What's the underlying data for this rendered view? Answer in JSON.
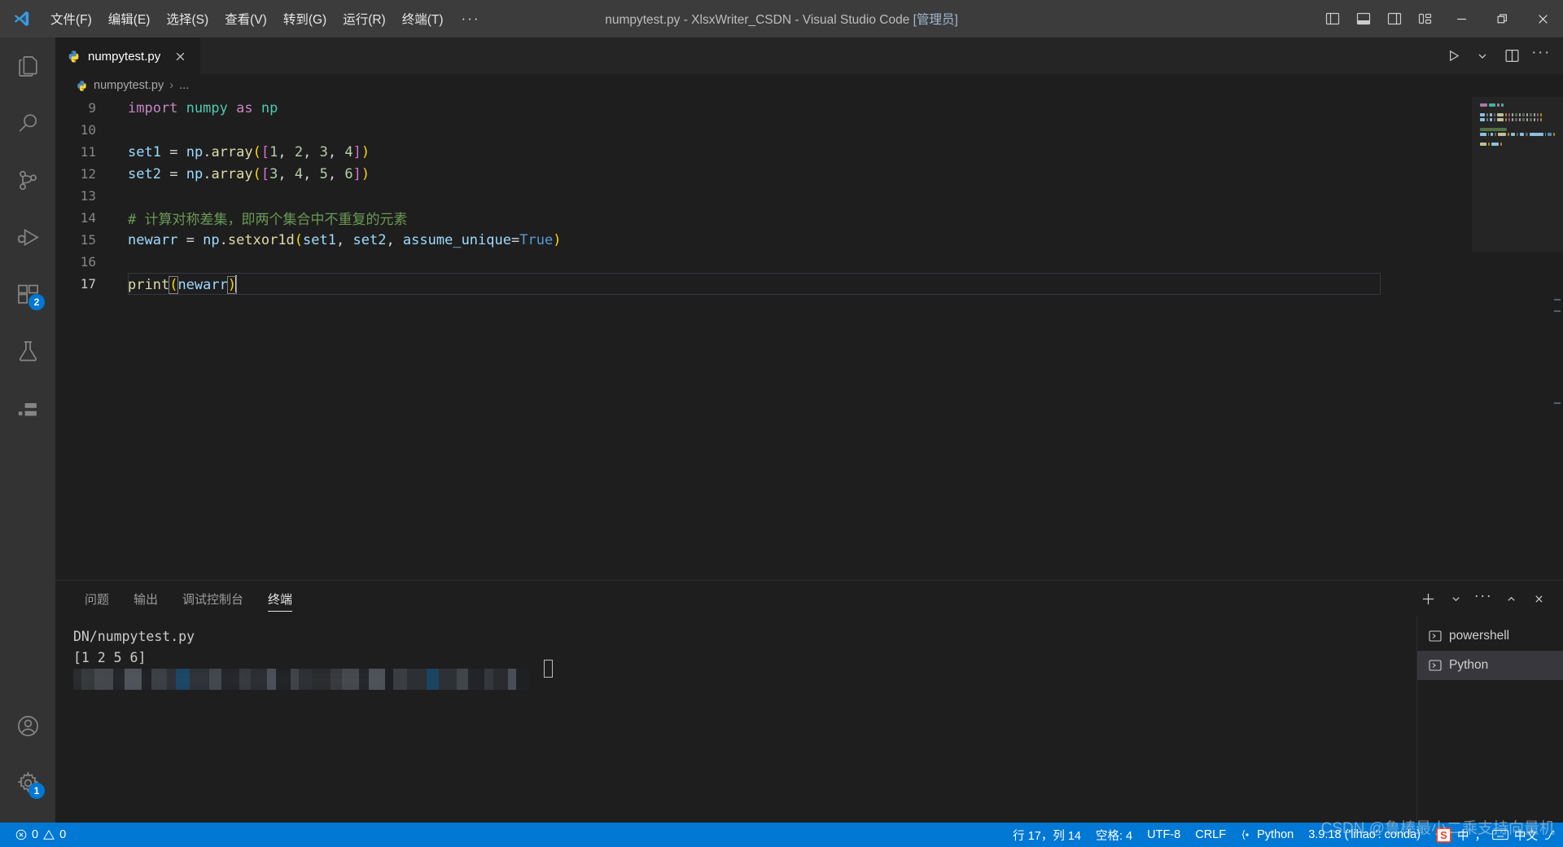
{
  "titlebar": {
    "logo_icon": "vscode-logo",
    "menus": [
      {
        "label": "文件(F)"
      },
      {
        "label": "编辑(E)"
      },
      {
        "label": "选择(S)"
      },
      {
        "label": "查看(V)"
      },
      {
        "label": "转到(G)"
      },
      {
        "label": "运行(R)"
      },
      {
        "label": "终端(T)"
      }
    ],
    "more_label": "···",
    "window_title": "numpytest.py - XlsxWriter_CSDN - Visual Studio Code ",
    "window_title_admin": "[管理员]",
    "layout_icons": [
      {
        "name": "toggle-primary-sidebar-icon"
      },
      {
        "name": "toggle-panel-icon"
      },
      {
        "name": "toggle-secondary-sidebar-icon"
      },
      {
        "name": "customize-layout-icon"
      }
    ],
    "window_controls": [
      {
        "name": "minimize-button"
      },
      {
        "name": "restore-button"
      },
      {
        "name": "close-button"
      }
    ]
  },
  "activitybar": {
    "top": [
      {
        "name": "explorer",
        "icon": "files-icon",
        "badge": ""
      },
      {
        "name": "search",
        "icon": "search-icon",
        "badge": ""
      },
      {
        "name": "source-control",
        "icon": "source-control-icon",
        "badge": ""
      },
      {
        "name": "run-and-debug",
        "icon": "run-debug-icon",
        "badge": ""
      },
      {
        "name": "extensions",
        "icon": "extensions-icon",
        "badge": "2"
      },
      {
        "name": "testing",
        "icon": "beaker-icon",
        "badge": ""
      },
      {
        "name": "remote-explorer",
        "icon": "remote-explorer-icon",
        "badge": ""
      }
    ],
    "bottom": [
      {
        "name": "accounts",
        "icon": "account-icon",
        "badge": ""
      },
      {
        "name": "manage-settings",
        "icon": "gear-icon",
        "badge": "1"
      }
    ]
  },
  "editor": {
    "tab": {
      "label": "numpytest.py",
      "icon": "python-icon",
      "close_icon": "close-icon"
    },
    "actions": [
      {
        "name": "run-python-file-button",
        "icon": "play-icon"
      },
      {
        "name": "run-options-dropdown",
        "icon": "chevron-down-icon"
      },
      {
        "name": "split-editor-right-button",
        "icon": "split-editor-icon"
      },
      {
        "name": "more-editor-actions-button",
        "icon": "ellipsis-icon"
      }
    ],
    "breadcrumb": {
      "file": "numpytest.py",
      "separator": "›",
      "trailing": "..."
    },
    "code": [
      {
        "no": "9",
        "active": false,
        "tokens": [
          {
            "t": "import",
            "c": "t-kw"
          },
          {
            "t": " ",
            "c": "t-plain"
          },
          {
            "t": "numpy",
            "c": "t-mod"
          },
          {
            "t": " ",
            "c": "t-plain"
          },
          {
            "t": "as",
            "c": "t-as"
          },
          {
            "t": " ",
            "c": "t-plain"
          },
          {
            "t": "np",
            "c": "t-mod"
          }
        ]
      },
      {
        "no": "10",
        "active": false,
        "tokens": []
      },
      {
        "no": "11",
        "active": false,
        "tokens": [
          {
            "t": "set1",
            "c": "t-var"
          },
          {
            "t": " ",
            "c": "t-plain"
          },
          {
            "t": "=",
            "c": "t-op"
          },
          {
            "t": " ",
            "c": "t-plain"
          },
          {
            "t": "np",
            "c": "t-var"
          },
          {
            "t": ".",
            "c": "t-plain"
          },
          {
            "t": "array",
            "c": "t-fn"
          },
          {
            "t": "(",
            "c": "t-par1"
          },
          {
            "t": "[",
            "c": "t-par2"
          },
          {
            "t": "1",
            "c": "t-num"
          },
          {
            "t": ", ",
            "c": "t-plain"
          },
          {
            "t": "2",
            "c": "t-num"
          },
          {
            "t": ", ",
            "c": "t-plain"
          },
          {
            "t": "3",
            "c": "t-num"
          },
          {
            "t": ", ",
            "c": "t-plain"
          },
          {
            "t": "4",
            "c": "t-num"
          },
          {
            "t": "]",
            "c": "t-par2"
          },
          {
            "t": ")",
            "c": "t-par1"
          }
        ]
      },
      {
        "no": "12",
        "active": false,
        "tokens": [
          {
            "t": "set2",
            "c": "t-var"
          },
          {
            "t": " ",
            "c": "t-plain"
          },
          {
            "t": "=",
            "c": "t-op"
          },
          {
            "t": " ",
            "c": "t-plain"
          },
          {
            "t": "np",
            "c": "t-var"
          },
          {
            "t": ".",
            "c": "t-plain"
          },
          {
            "t": "array",
            "c": "t-fn"
          },
          {
            "t": "(",
            "c": "t-par1"
          },
          {
            "t": "[",
            "c": "t-par2"
          },
          {
            "t": "3",
            "c": "t-num"
          },
          {
            "t": ", ",
            "c": "t-plain"
          },
          {
            "t": "4",
            "c": "t-num"
          },
          {
            "t": ", ",
            "c": "t-plain"
          },
          {
            "t": "5",
            "c": "t-num"
          },
          {
            "t": ", ",
            "c": "t-plain"
          },
          {
            "t": "6",
            "c": "t-num"
          },
          {
            "t": "]",
            "c": "t-par2"
          },
          {
            "t": ")",
            "c": "t-par1"
          }
        ]
      },
      {
        "no": "13",
        "active": false,
        "tokens": []
      },
      {
        "no": "14",
        "active": false,
        "tokens": [
          {
            "t": "# 计算对称差集，即两个集合中不重复的元素",
            "c": "t-cmt"
          }
        ]
      },
      {
        "no": "15",
        "active": false,
        "tokens": [
          {
            "t": "newarr",
            "c": "t-var"
          },
          {
            "t": " ",
            "c": "t-plain"
          },
          {
            "t": "=",
            "c": "t-op"
          },
          {
            "t": " ",
            "c": "t-plain"
          },
          {
            "t": "np",
            "c": "t-var"
          },
          {
            "t": ".",
            "c": "t-plain"
          },
          {
            "t": "setxor1d",
            "c": "t-fn"
          },
          {
            "t": "(",
            "c": "t-par1"
          },
          {
            "t": "set1",
            "c": "t-var"
          },
          {
            "t": ", ",
            "c": "t-plain"
          },
          {
            "t": "set2",
            "c": "t-var"
          },
          {
            "t": ", ",
            "c": "t-plain"
          },
          {
            "t": "assume_unique",
            "c": "t-var"
          },
          {
            "t": "=",
            "c": "t-op"
          },
          {
            "t": "True",
            "c": "t-const"
          },
          {
            "t": ")",
            "c": "t-par1"
          }
        ]
      },
      {
        "no": "16",
        "active": false,
        "tokens": []
      },
      {
        "no": "17",
        "active": true,
        "tokens": [
          {
            "t": "print",
            "c": "t-fn"
          },
          {
            "t": "(",
            "c": "t-par1 brk"
          },
          {
            "t": "newarr",
            "c": "t-var"
          },
          {
            "t": ")",
            "c": "t-par1 brk"
          }
        ]
      }
    ]
  },
  "panel": {
    "tabs": [
      {
        "label": "问题",
        "active": false
      },
      {
        "label": "输出",
        "active": false
      },
      {
        "label": "调试控制台",
        "active": false
      },
      {
        "label": "终端",
        "active": true
      }
    ],
    "actions": [
      {
        "name": "new-terminal-button",
        "icon": "plus-icon"
      },
      {
        "name": "terminal-profile-dropdown",
        "icon": "chevron-down-icon"
      },
      {
        "name": "panel-more-actions-button",
        "icon": "ellipsis-icon"
      },
      {
        "name": "maximize-panel-button",
        "icon": "chevron-up-icon"
      },
      {
        "name": "close-panel-button",
        "icon": "close-icon"
      }
    ],
    "terminal_output": [
      "DN/numpytest.py",
      "[1 2 5 6]"
    ],
    "terminal_prompt_redacted": "PS C:\\Users\\xxxxxxx\\Desktop\\xxxxxxxxx>",
    "terminal_tabs": [
      {
        "label": "powershell",
        "icon": "terminal-icon",
        "active": false
      },
      {
        "label": "Python",
        "icon": "terminal-icon",
        "active": true
      }
    ]
  },
  "statusbar": {
    "left": [
      {
        "name": "errors-warnings",
        "error_icon": "error-circle-icon",
        "errors": "0",
        "warning_icon": "warning-triangle-icon",
        "warnings": "0"
      }
    ],
    "right": [
      {
        "name": "cursor-position",
        "label": "行 17，列 14"
      },
      {
        "name": "indentation",
        "label": "空格: 4"
      },
      {
        "name": "encoding",
        "label": "UTF-8"
      },
      {
        "name": "eol",
        "label": "CRLF"
      },
      {
        "name": "language-mode",
        "label": "Python",
        "icon": "brackets-icon"
      },
      {
        "name": "python-interpreter",
        "label": "3.9.18 ('lihao': conda)"
      }
    ],
    "accent_color": "#0078d4"
  },
  "watermark": {
    "text": "CSDN @鲁棒最小二乘支持向量机"
  },
  "ime": {
    "s_label": "S",
    "mode_label": "中",
    "punct_label": "，",
    "keyboard_icon": "keyboard-icon",
    "tray_label": "中文",
    "pen_icon": "pen-icon"
  }
}
